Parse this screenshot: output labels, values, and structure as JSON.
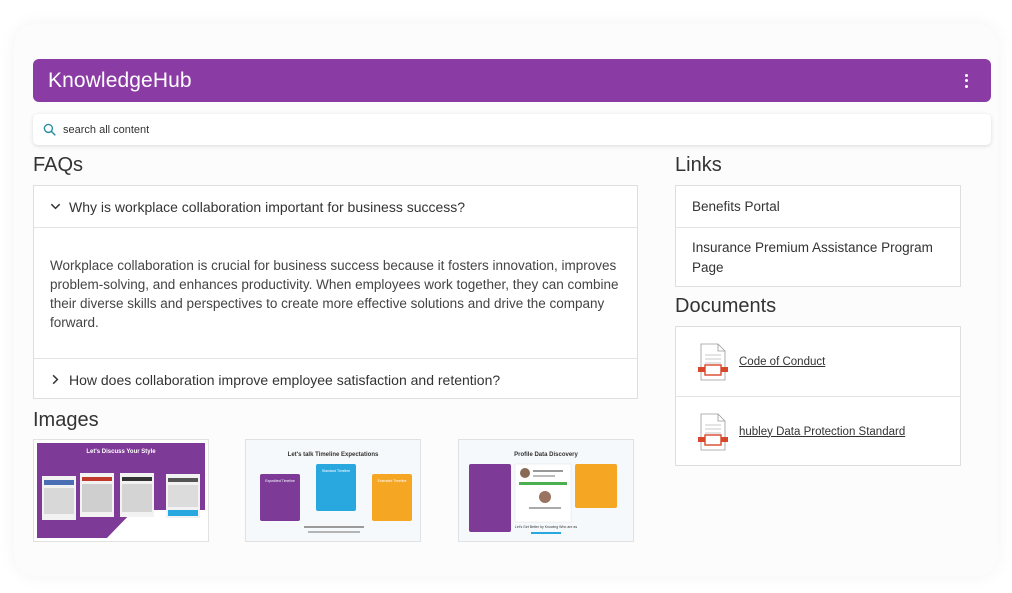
{
  "app": {
    "title": "KnowledgeHub"
  },
  "search": {
    "placeholder": "search all content"
  },
  "sections": {
    "faqs": "FAQs",
    "images": "Images",
    "links": "Links",
    "documents": "Documents"
  },
  "faqs": [
    {
      "question": "Why is workplace collaboration important for business success?",
      "expanded": true,
      "answer": "Workplace collaboration is crucial for business success because it fosters innovation, improves problem-solving, and enhances productivity. When employees work together, they can combine their diverse skills and perspectives to create more effective solutions and drive the company forward."
    },
    {
      "question": "How does collaboration improve employee satisfaction and retention?",
      "expanded": false
    }
  ],
  "images": [
    {
      "heading": "Let's Discuss Your Style",
      "theme": "purple"
    },
    {
      "heading": "Let's talk Timeline Expectations",
      "theme": "light",
      "cards": [
        "Expedited Timeline",
        "Standard Timeline",
        "Extended Timeline"
      ]
    },
    {
      "heading": "Profile Data Discovery",
      "theme": "light",
      "footer": "Let's Get Better by Knowing Who are as"
    }
  ],
  "links": [
    "Benefits Portal",
    "Insurance Premium Assistance Program Page"
  ],
  "documents": [
    "Code of Conduct",
    "hubley Data Protection Standard"
  ],
  "colors": {
    "brand": "#8a3ba4",
    "card_blue": "#29a8e0",
    "card_orange": "#f5a623",
    "doc_red": "#d9472b"
  },
  "icons": {
    "menu": "more-vert-icon",
    "search": "search-icon",
    "expanded": "chevron-down-icon",
    "collapsed": "chevron-right-icon",
    "document": "document-icon"
  }
}
